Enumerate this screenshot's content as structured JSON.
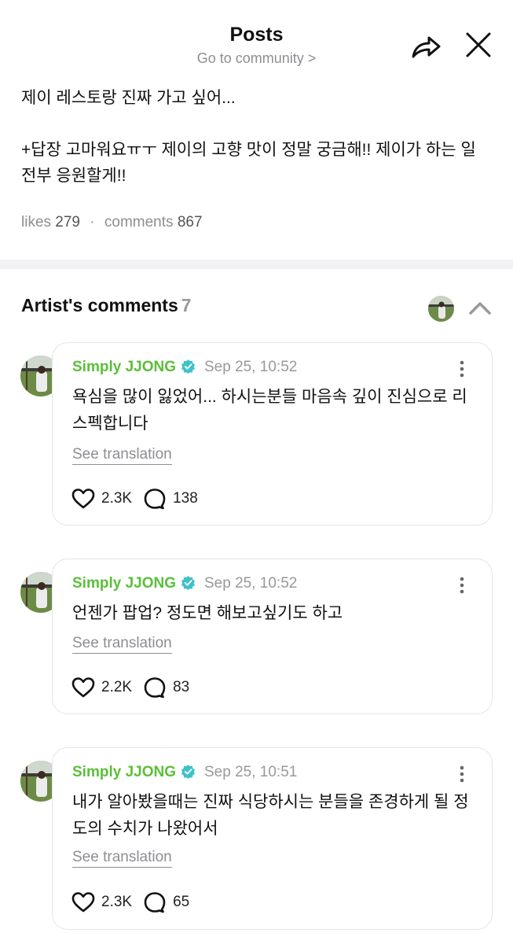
{
  "header": {
    "title": "Posts",
    "community_link": "Go to community >"
  },
  "post": {
    "body": "제이 레스토랑 진짜 가고 싶어...\n\n+답장 고마워요ㅠㅜ 제이의 고향 맛이 정말 궁금해!! 제이가 하는 일 전부 응원할게!!",
    "likes_label": "likes",
    "likes_count": "279",
    "separator": "·",
    "comments_label": "comments",
    "comments_count": "867"
  },
  "artist_comments": {
    "title": "Artist's comments",
    "count": "7",
    "comments": [
      {
        "author": "Simply JJONG",
        "time": "Sep 25, 10:52",
        "text": "욕심을 많이 잃었어... 하시는분들 마음속 깊이 진심으로 리스펙합니다",
        "translate_label": "See translation",
        "likes": "2.3K",
        "replies": "138"
      },
      {
        "author": "Simply JJONG",
        "time": "Sep 25, 10:52",
        "text": "언젠가 팝업? 정도면 해보고싶기도 하고",
        "translate_label": "See translation",
        "likes": "2.2K",
        "replies": "83"
      },
      {
        "author": "Simply JJONG",
        "time": "Sep 25, 10:51",
        "text": "내가 알아봤을때는 진짜 식당하시는 분들을 존경하게 될 정도의 수치가 나왔어서",
        "translate_label": "See translation",
        "likes": "2.3K",
        "replies": "65"
      }
    ]
  },
  "colors": {
    "author_green": "#5bbf3a",
    "verified_teal": "#3fc1c9",
    "muted_gray": "#8e8e93",
    "divider": "#f2f2f4"
  },
  "icons": [
    "share-icon",
    "close-icon",
    "chevron-up-icon",
    "verified-badge-icon",
    "more-vertical-icon",
    "heart-icon",
    "comment-bubble-icon"
  ]
}
